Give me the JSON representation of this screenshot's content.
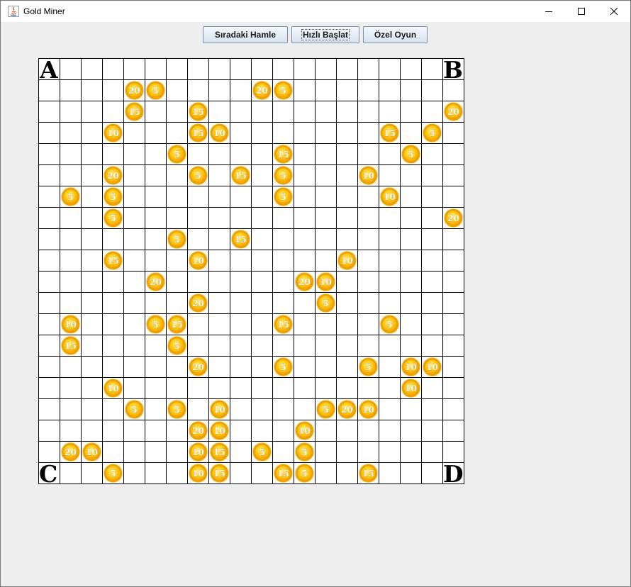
{
  "window": {
    "title": "Gold Miner",
    "app_icon": "java-icon",
    "controls": [
      "minimize-icon",
      "maximize-icon",
      "close-icon"
    ]
  },
  "toolbar": {
    "next_move_label": "Sıradaki Hamle",
    "quick_start_label": "Hızlı Başlat",
    "custom_game_label": "Özel Oyun"
  },
  "board": {
    "rows": 20,
    "cols": 20,
    "corners": {
      "top_left": "A",
      "top_right": "B",
      "bottom_left": "C",
      "bottom_right": "D"
    },
    "colors": {
      "coin_outer": "#f2a400",
      "coin_inner": "#ffd21f",
      "coin_highlight": "#fff3a0",
      "grid": "#000000"
    },
    "coins": [
      {
        "row": 1,
        "col": 4,
        "value": "20"
      },
      {
        "row": 1,
        "col": 5,
        "value": "5"
      },
      {
        "row": 1,
        "col": 10,
        "value": "20"
      },
      {
        "row": 1,
        "col": 11,
        "value": "5"
      },
      {
        "row": 2,
        "col": 4,
        "value": "15"
      },
      {
        "row": 2,
        "col": 7,
        "value": "15"
      },
      {
        "row": 2,
        "col": 19,
        "value": "20"
      },
      {
        "row": 3,
        "col": 3,
        "value": "10"
      },
      {
        "row": 3,
        "col": 7,
        "value": "15"
      },
      {
        "row": 3,
        "col": 8,
        "value": "10"
      },
      {
        "row": 3,
        "col": 16,
        "value": "15"
      },
      {
        "row": 3,
        "col": 18,
        "value": "5"
      },
      {
        "row": 4,
        "col": 6,
        "value": "5"
      },
      {
        "row": 4,
        "col": 11,
        "value": "15"
      },
      {
        "row": 4,
        "col": 17,
        "value": "5"
      },
      {
        "row": 5,
        "col": 3,
        "value": "20"
      },
      {
        "row": 5,
        "col": 7,
        "value": "5"
      },
      {
        "row": 5,
        "col": 9,
        "value": "15"
      },
      {
        "row": 5,
        "col": 11,
        "value": "5"
      },
      {
        "row": 5,
        "col": 15,
        "value": "10"
      },
      {
        "row": 6,
        "col": 1,
        "value": "5"
      },
      {
        "row": 6,
        "col": 3,
        "value": "5"
      },
      {
        "row": 6,
        "col": 11,
        "value": "5"
      },
      {
        "row": 6,
        "col": 16,
        "value": "10"
      },
      {
        "row": 7,
        "col": 3,
        "value": "5"
      },
      {
        "row": 7,
        "col": 19,
        "value": "20"
      },
      {
        "row": 8,
        "col": 6,
        "value": "5"
      },
      {
        "row": 8,
        "col": 9,
        "value": "15"
      },
      {
        "row": 9,
        "col": 3,
        "value": "15"
      },
      {
        "row": 9,
        "col": 7,
        "value": "10"
      },
      {
        "row": 9,
        "col": 14,
        "value": "10"
      },
      {
        "row": 10,
        "col": 5,
        "value": "20"
      },
      {
        "row": 10,
        "col": 12,
        "value": "20"
      },
      {
        "row": 10,
        "col": 13,
        "value": "10"
      },
      {
        "row": 11,
        "col": 7,
        "value": "20"
      },
      {
        "row": 11,
        "col": 13,
        "value": "5"
      },
      {
        "row": 12,
        "col": 1,
        "value": "10"
      },
      {
        "row": 12,
        "col": 5,
        "value": "5"
      },
      {
        "row": 12,
        "col": 6,
        "value": "15"
      },
      {
        "row": 12,
        "col": 11,
        "value": "15"
      },
      {
        "row": 12,
        "col": 16,
        "value": "5"
      },
      {
        "row": 13,
        "col": 1,
        "value": "15"
      },
      {
        "row": 13,
        "col": 6,
        "value": "5"
      },
      {
        "row": 14,
        "col": 7,
        "value": "20"
      },
      {
        "row": 14,
        "col": 11,
        "value": "5"
      },
      {
        "row": 14,
        "col": 15,
        "value": "5"
      },
      {
        "row": 14,
        "col": 17,
        "value": "10"
      },
      {
        "row": 14,
        "col": 18,
        "value": "10"
      },
      {
        "row": 15,
        "col": 3,
        "value": "10"
      },
      {
        "row": 15,
        "col": 17,
        "value": "10"
      },
      {
        "row": 16,
        "col": 4,
        "value": "5"
      },
      {
        "row": 16,
        "col": 6,
        "value": "5"
      },
      {
        "row": 16,
        "col": 8,
        "value": "10"
      },
      {
        "row": 16,
        "col": 13,
        "value": "5"
      },
      {
        "row": 16,
        "col": 14,
        "value": "20"
      },
      {
        "row": 16,
        "col": 15,
        "value": "10"
      },
      {
        "row": 17,
        "col": 7,
        "value": "20"
      },
      {
        "row": 17,
        "col": 8,
        "value": "10"
      },
      {
        "row": 17,
        "col": 12,
        "value": "10"
      },
      {
        "row": 18,
        "col": 1,
        "value": "20"
      },
      {
        "row": 18,
        "col": 2,
        "value": "10"
      },
      {
        "row": 18,
        "col": 7,
        "value": "10"
      },
      {
        "row": 18,
        "col": 8,
        "value": "15"
      },
      {
        "row": 18,
        "col": 10,
        "value": "5"
      },
      {
        "row": 18,
        "col": 12,
        "value": "5"
      },
      {
        "row": 19,
        "col": 3,
        "value": "5"
      },
      {
        "row": 19,
        "col": 7,
        "value": "10"
      },
      {
        "row": 19,
        "col": 8,
        "value": "15"
      },
      {
        "row": 19,
        "col": 11,
        "value": "15"
      },
      {
        "row": 19,
        "col": 12,
        "value": "5"
      },
      {
        "row": 19,
        "col": 15,
        "value": "15"
      }
    ]
  }
}
